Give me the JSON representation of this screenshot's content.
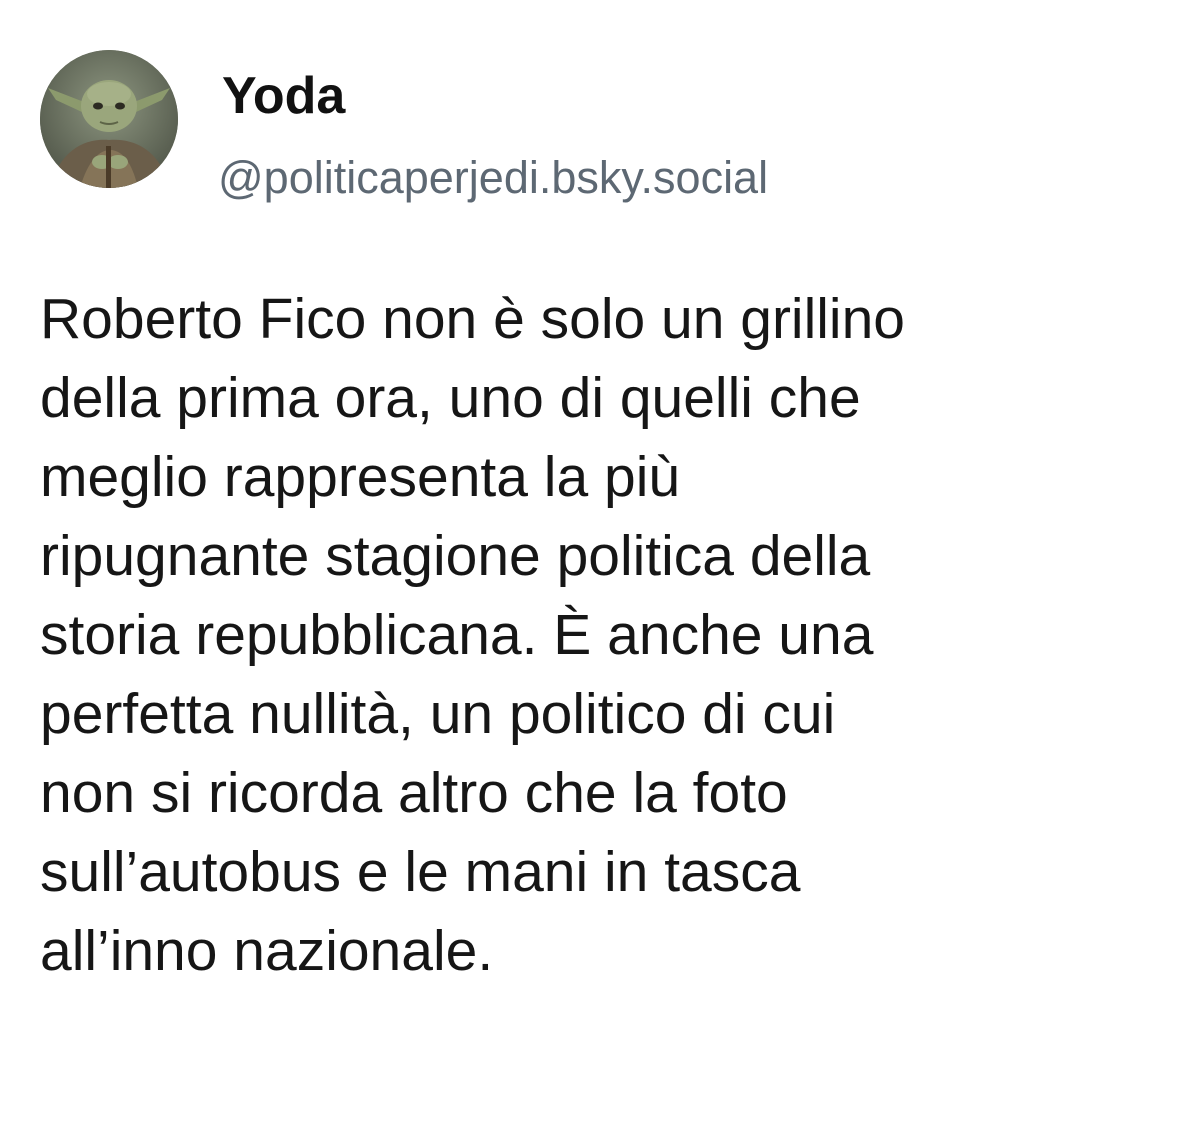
{
  "author": {
    "name": "Yoda",
    "handle": "@politicaperjedi.bsky.social",
    "avatar_icon": "yoda-avatar"
  },
  "post": {
    "lines": [
      "Roberto Fico non è solo un grillino",
      "della prima ora, uno di quelli che",
      "meglio rappresenta la più",
      "ripugnante stagione politica della",
      "storia repubblicana. È anche una",
      "perfetta nullità, un politico di cui",
      "non si ricorda altro che la foto",
      "sull’autobus e le mani in tasca",
      "all’inno nazionale."
    ]
  },
  "colors": {
    "background": "#ffffff",
    "name": "#111111",
    "handle": "#5d6873",
    "body_text": "#161616"
  }
}
